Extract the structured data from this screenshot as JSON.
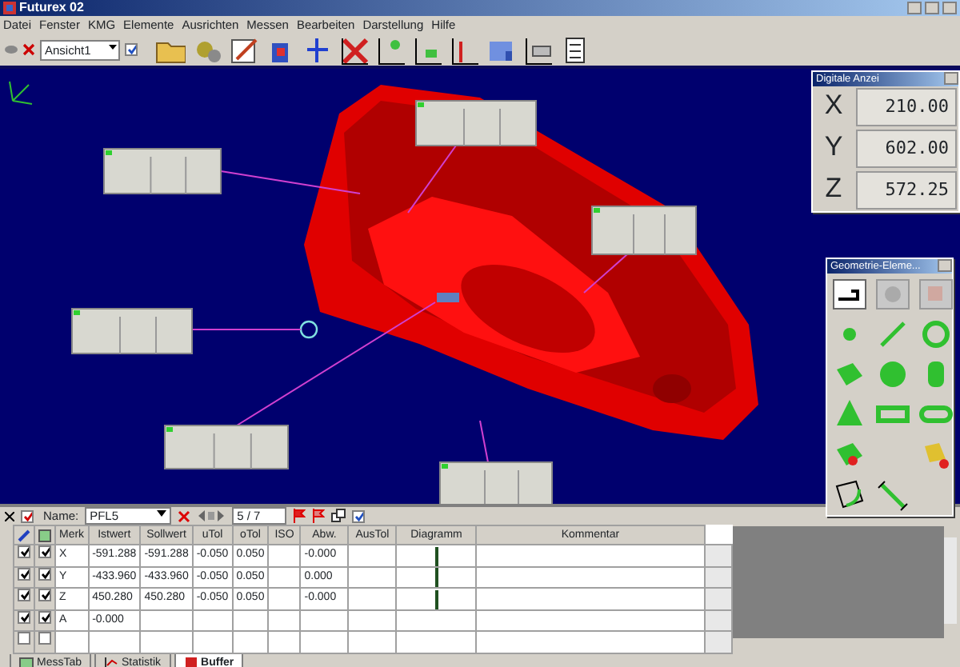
{
  "window": {
    "title": "Futurex 02"
  },
  "menu": [
    "Datei",
    "Fenster",
    "KMG",
    "Elemente",
    "Ausrichten",
    "Messen",
    "Bearbeiten",
    "Darstellung",
    "Hilfe"
  ],
  "toolbar": {
    "view_combo": {
      "value": "Ansicht1"
    },
    "apply_checked": true
  },
  "readout": {
    "title": "Digitale Anzei",
    "axes": [
      {
        "label": "X",
        "value": "210.00"
      },
      {
        "label": "Y",
        "value": "602.00"
      },
      {
        "label": "Z",
        "value": "572.25"
      }
    ]
  },
  "geometry_palette": {
    "title": "Geometrie-Eleme..."
  },
  "feature_bar": {
    "checked": true,
    "name_label": "Name:",
    "name": "PFL5",
    "counter": "5 / 7",
    "show_checked": true
  },
  "table": {
    "columns": [
      "Merk",
      "Istwert",
      "Sollwert",
      "uTol",
      "oTol",
      "ISO",
      "Abw.",
      "AusTol",
      "Diagramm",
      "Kommentar"
    ],
    "rows": [
      {
        "checked_1": true,
        "checked_2": true,
        "diagram": true,
        "cells": [
          "X",
          "-591.288",
          "-591.288",
          "-0.050",
          "0.050",
          "",
          "-0.000",
          "",
          ""
        ]
      },
      {
        "checked_1": true,
        "checked_2": true,
        "diagram": true,
        "cells": [
          "Y",
          "-433.960",
          "-433.960",
          "-0.050",
          "0.050",
          "",
          "0.000",
          "",
          ""
        ]
      },
      {
        "checked_1": true,
        "checked_2": true,
        "diagram": true,
        "cells": [
          "Z",
          "450.280",
          "450.280",
          "-0.050",
          "0.050",
          "",
          "-0.000",
          "",
          ""
        ]
      },
      {
        "checked_1": true,
        "checked_2": true,
        "diagram": false,
        "cells": [
          "A",
          "-0.000",
          "",
          "",
          "",
          "",
          "",
          "",
          ""
        ]
      },
      {
        "checked_1": false,
        "checked_2": false,
        "diagram": false,
        "cells": [
          "",
          "",
          "",
          "",
          "",
          "",
          "",
          "",
          ""
        ]
      }
    ]
  },
  "tabs": [
    {
      "label": "MessTab",
      "selected": false
    },
    {
      "label": "Statistik",
      "selected": false
    },
    {
      "label": "Buffer",
      "selected": true
    }
  ]
}
